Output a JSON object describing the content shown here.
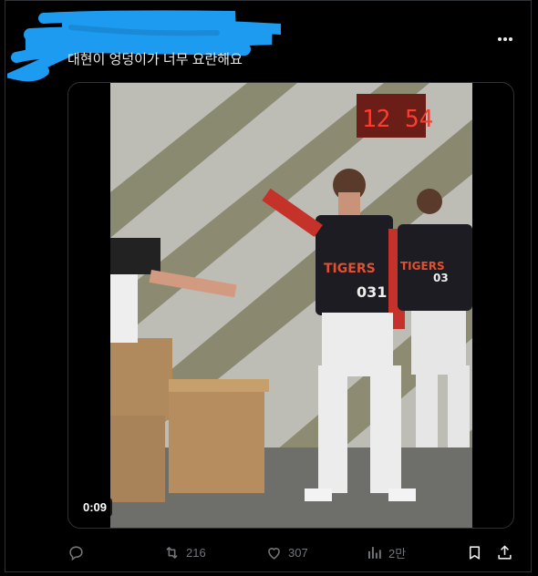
{
  "tweet": {
    "text": "대현이 엉덩이가 너무 요란해요",
    "timestamp": "0:09"
  },
  "actions": {
    "reply_count": "",
    "retweet_count": "216",
    "like_count": "307",
    "view_count": "2만"
  },
  "icons": [
    "more-icon",
    "reply-icon",
    "retweet-icon",
    "like-icon",
    "views-icon",
    "bookmark-icon",
    "share-icon"
  ],
  "colors": {
    "background": "#000000",
    "text": "#e7e9ea",
    "muted": "#71767b",
    "border": "#2f3336",
    "scribble": "#1d9bf0"
  }
}
